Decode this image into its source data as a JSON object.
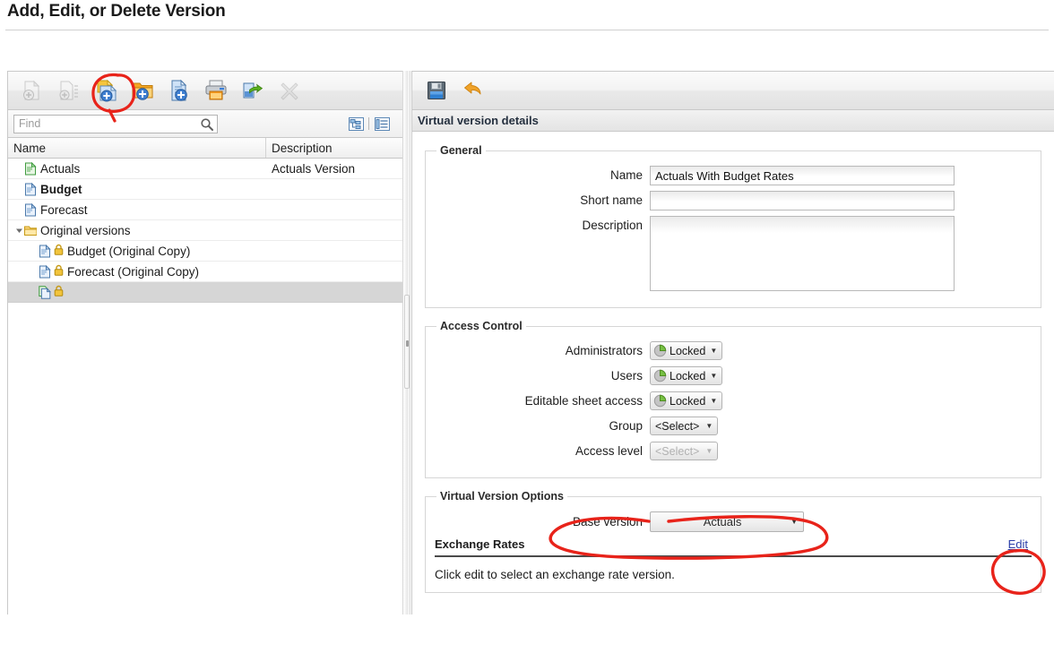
{
  "page": {
    "title": "Add, Edit, or Delete Version"
  },
  "left_toolbar": {
    "buttons": [
      {
        "name": "add-version-disabled",
        "icon": "add-version-icon",
        "enabled": false
      },
      {
        "name": "add-version-list-disabled",
        "icon": "add-version-list-icon",
        "enabled": false
      },
      {
        "name": "new-virtual-version",
        "icon": "new-page-add-icon",
        "enabled": true
      },
      {
        "name": "new-folder",
        "icon": "folder-add-icon",
        "enabled": true
      },
      {
        "name": "new-document",
        "icon": "document-add-icon",
        "enabled": true
      },
      {
        "name": "print",
        "icon": "printer-icon",
        "enabled": true
      },
      {
        "name": "export",
        "icon": "export-arrow-icon",
        "enabled": true
      },
      {
        "name": "delete",
        "icon": "cross-x-icon",
        "enabled": false
      }
    ]
  },
  "find": {
    "placeholder": "Find",
    "value": "",
    "search_icon": "search-icon",
    "toggle_tree_icon": "tree-view-icon",
    "toggle_list_icon": "list-view-icon"
  },
  "grid": {
    "columns": [
      "Name",
      "Description"
    ],
    "rows": [
      {
        "name": "Actuals",
        "description": "Actuals Version",
        "indent": 1,
        "icon": "document-green-icon",
        "bold": false,
        "locked": false,
        "twisty": "",
        "selected": false
      },
      {
        "name": "Budget",
        "description": "",
        "indent": 1,
        "icon": "document-blue-icon",
        "bold": true,
        "locked": false,
        "twisty": "",
        "selected": false
      },
      {
        "name": "Forecast",
        "description": "",
        "indent": 1,
        "icon": "document-blue-icon",
        "bold": false,
        "locked": false,
        "twisty": "",
        "selected": false
      },
      {
        "name": "Original versions",
        "description": "",
        "indent": 0,
        "icon": "folder-open-icon",
        "bold": false,
        "locked": false,
        "twisty": "expanded",
        "selected": false
      },
      {
        "name": "Budget (Original Copy)",
        "description": "",
        "indent": 2,
        "icon": "document-blue-icon",
        "bold": false,
        "locked": true,
        "twisty": "",
        "selected": false
      },
      {
        "name": "Forecast (Original Copy)",
        "description": "",
        "indent": 2,
        "icon": "document-blue-icon",
        "bold": false,
        "locked": true,
        "twisty": "",
        "selected": false
      },
      {
        "name": "",
        "description": "",
        "indent": 2,
        "icon": "copy-document-icon",
        "bold": false,
        "locked": true,
        "twisty": "",
        "selected": true
      }
    ]
  },
  "right_toolbar": {
    "save_icon": "save-floppy-icon",
    "undo_icon": "undo-arrow-icon"
  },
  "details": {
    "header": "Virtual version details",
    "general": {
      "legend": "General",
      "name_label": "Name",
      "name_value": "Actuals With Budget Rates",
      "short_name_label": "Short name",
      "short_name_value": "",
      "description_label": "Description",
      "description_value": ""
    },
    "access_control": {
      "legend": "Access Control",
      "administrators_label": "Administrators",
      "administrators_value": "Locked",
      "users_label": "Users",
      "users_value": "Locked",
      "editable_sheet_label": "Editable sheet access",
      "editable_sheet_value": "Locked",
      "group_label": "Group",
      "group_value": "<Select>",
      "access_level_label": "Access level",
      "access_level_value": "<Select>"
    },
    "virtual_options": {
      "legend": "Virtual Version Options",
      "base_version_label": "Base version",
      "base_version_value": "Actuals",
      "exchange_rates_title": "Exchange Rates",
      "edit_link": "Edit",
      "exchange_note": "Click edit to select an exchange rate version."
    }
  },
  "annotations": {
    "color": "#e8231a",
    "items": [
      "toolbar-new-virtual-version-circle",
      "base-version-circle",
      "edit-link-circle"
    ]
  }
}
